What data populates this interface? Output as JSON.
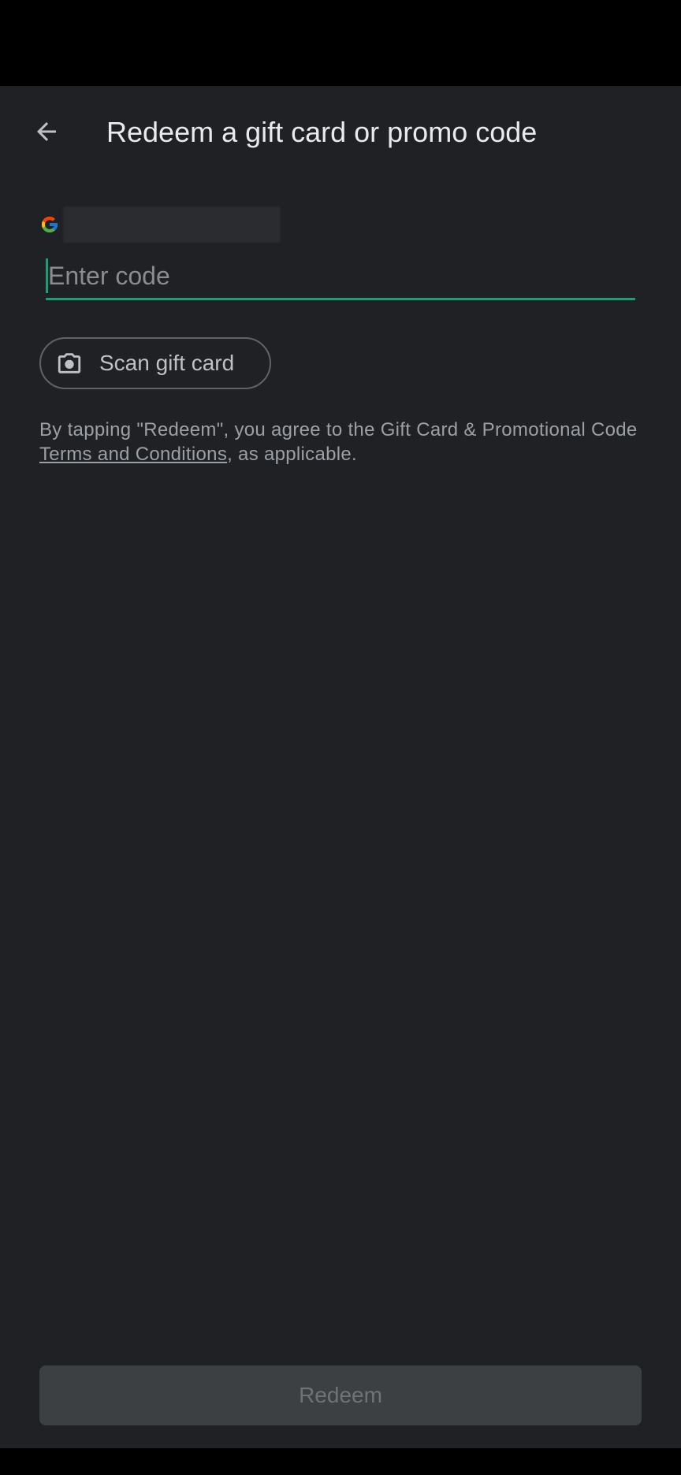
{
  "header": {
    "title": "Redeem a gift card or promo code",
    "back_icon": "arrow-back-icon"
  },
  "account": {
    "logo_icon": "google-g-icon",
    "email": ""
  },
  "code_input": {
    "value": "",
    "placeholder": "Enter code",
    "focused": true,
    "accent_color": "#1a9e76"
  },
  "scan_button": {
    "icon": "camera-icon",
    "label": "Scan gift card"
  },
  "terms": {
    "prefix": "By tapping \"Redeem\", you agree to the Gift Card & Promotional Code ",
    "link_label": "Terms and Conditions",
    "suffix": ", as applicable."
  },
  "redeem_button": {
    "label": "Redeem",
    "enabled": false
  },
  "colors": {
    "background": "#202124",
    "text_primary": "#e8eaed",
    "text_secondary": "#9aa0a6"
  }
}
